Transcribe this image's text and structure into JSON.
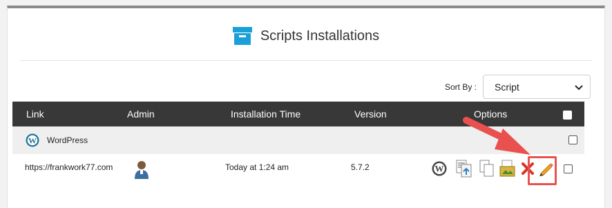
{
  "page": {
    "title": "Scripts Installations",
    "sort_label": "Sort By :",
    "sort_value": "Script"
  },
  "table": {
    "columns": [
      "Link",
      "Admin",
      "Installation Time",
      "Version",
      "Options"
    ],
    "group": {
      "name": "WordPress"
    },
    "rows": [
      {
        "link": "https://frankwork77.com",
        "installation_time": "Today at 1:24 am",
        "version": "5.7.2",
        "options": [
          "wordpress-icon",
          "backup-icon",
          "clone-icon",
          "staging-icon",
          "remove-icon",
          "edit-icon"
        ]
      }
    ]
  },
  "colors": {
    "header_bg": "#383838",
    "group_bg": "#efefef",
    "title_icon": "#1aa0d8",
    "highlight": "#e9514f",
    "edit_icon": "#f3a51f"
  }
}
